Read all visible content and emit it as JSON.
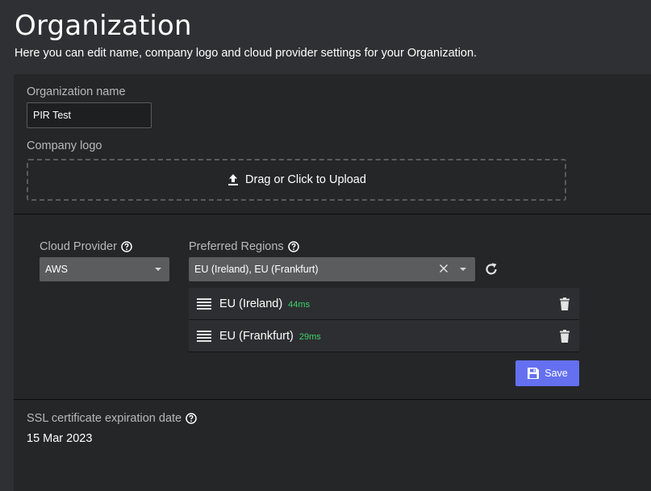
{
  "header": {
    "title": "Organization",
    "description": "Here you can edit name, company logo and cloud provider settings for your Organization."
  },
  "organization": {
    "name_label": "Organization name",
    "name_value": "PIR Test",
    "logo_label": "Company logo",
    "upload_text": "Drag or Click to Upload",
    "upload_icon": "upload-icon"
  },
  "cloud": {
    "provider_label": "Cloud Provider",
    "provider_value": "AWS",
    "regions_label": "Preferred Regions",
    "regions_value": "EU (Ireland), EU (Frankfurt)",
    "regions": [
      {
        "name": "EU (Ireland)",
        "latency": "44ms"
      },
      {
        "name": "EU (Frankfurt)",
        "latency": "29ms"
      }
    ],
    "save_label": "Save"
  },
  "ssl": {
    "label": "SSL certificate expiration date",
    "value": "15 Mar 2023"
  },
  "colors": {
    "background": "#2f3033",
    "card": "#252628",
    "accent": "#6470f0",
    "latency": "#3fd36a"
  }
}
